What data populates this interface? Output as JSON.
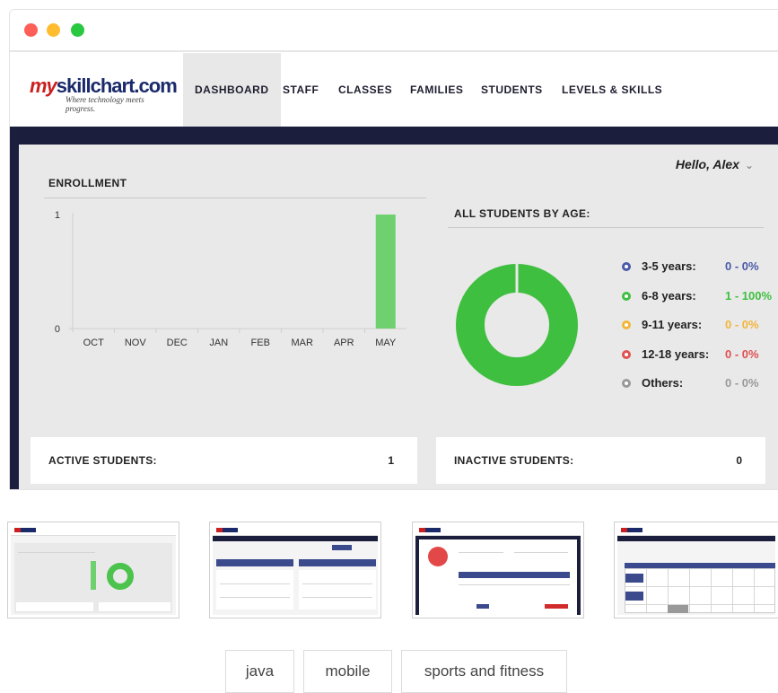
{
  "window": {
    "controls": [
      "close",
      "minimize",
      "maximize"
    ]
  },
  "brand": {
    "name_prefix": "my",
    "name_rest": "skillchart.com",
    "tagline": "Where technology meets progress."
  },
  "nav": {
    "items": [
      "DASHBOARD",
      "STAFF",
      "CLASSES",
      "FAMILIES",
      "STUDENTS",
      "LEVELS & SKILLS"
    ],
    "active": "DASHBOARD"
  },
  "user": {
    "greeting": "Hello,  Alex"
  },
  "enrollment": {
    "title": "ENROLLMENT"
  },
  "age": {
    "title": "ALL STUDENTS BY AGE:"
  },
  "chart_data": [
    {
      "type": "bar",
      "categories": [
        "OCT",
        "NOV",
        "DEC",
        "JAN",
        "FEB",
        "MAR",
        "APR",
        "MAY"
      ],
      "values": [
        0,
        0,
        0,
        0,
        0,
        0,
        0,
        1
      ],
      "ylim": [
        0,
        1
      ],
      "yticks": [
        "0",
        "1"
      ],
      "color": "#6fd06f",
      "grid": false
    },
    {
      "type": "pie",
      "style": "donut",
      "categories": [
        "3-5 years:",
        "6-8 years:",
        "9-11 years:",
        "12-18 years:",
        "Others:"
      ],
      "values": [
        0,
        1,
        0,
        0,
        0
      ],
      "labels": [
        "0 - 0%",
        "1 - 100%",
        "0 - 0%",
        "0 - 0%",
        "0 - 0%"
      ],
      "colors": [
        "#4a5aa8",
        "#3fbf3f",
        "#f2b53a",
        "#e05050",
        "#999999"
      ],
      "value_colors": [
        "#4a5aa8",
        "#3fbf3f",
        "#f2b53a",
        "#e05050",
        "#999999"
      ],
      "legend": "right"
    }
  ],
  "stats": {
    "active_label": "ACTIVE STUDENTS:",
    "active_value": "1",
    "inactive_label": "INACTIVE STUDENTS:",
    "inactive_value": "0"
  },
  "thumbnails": [
    "dashboard",
    "levels",
    "student-profile",
    "calendar"
  ],
  "tags": [
    "java",
    "mobile",
    "sports and fitness"
  ]
}
